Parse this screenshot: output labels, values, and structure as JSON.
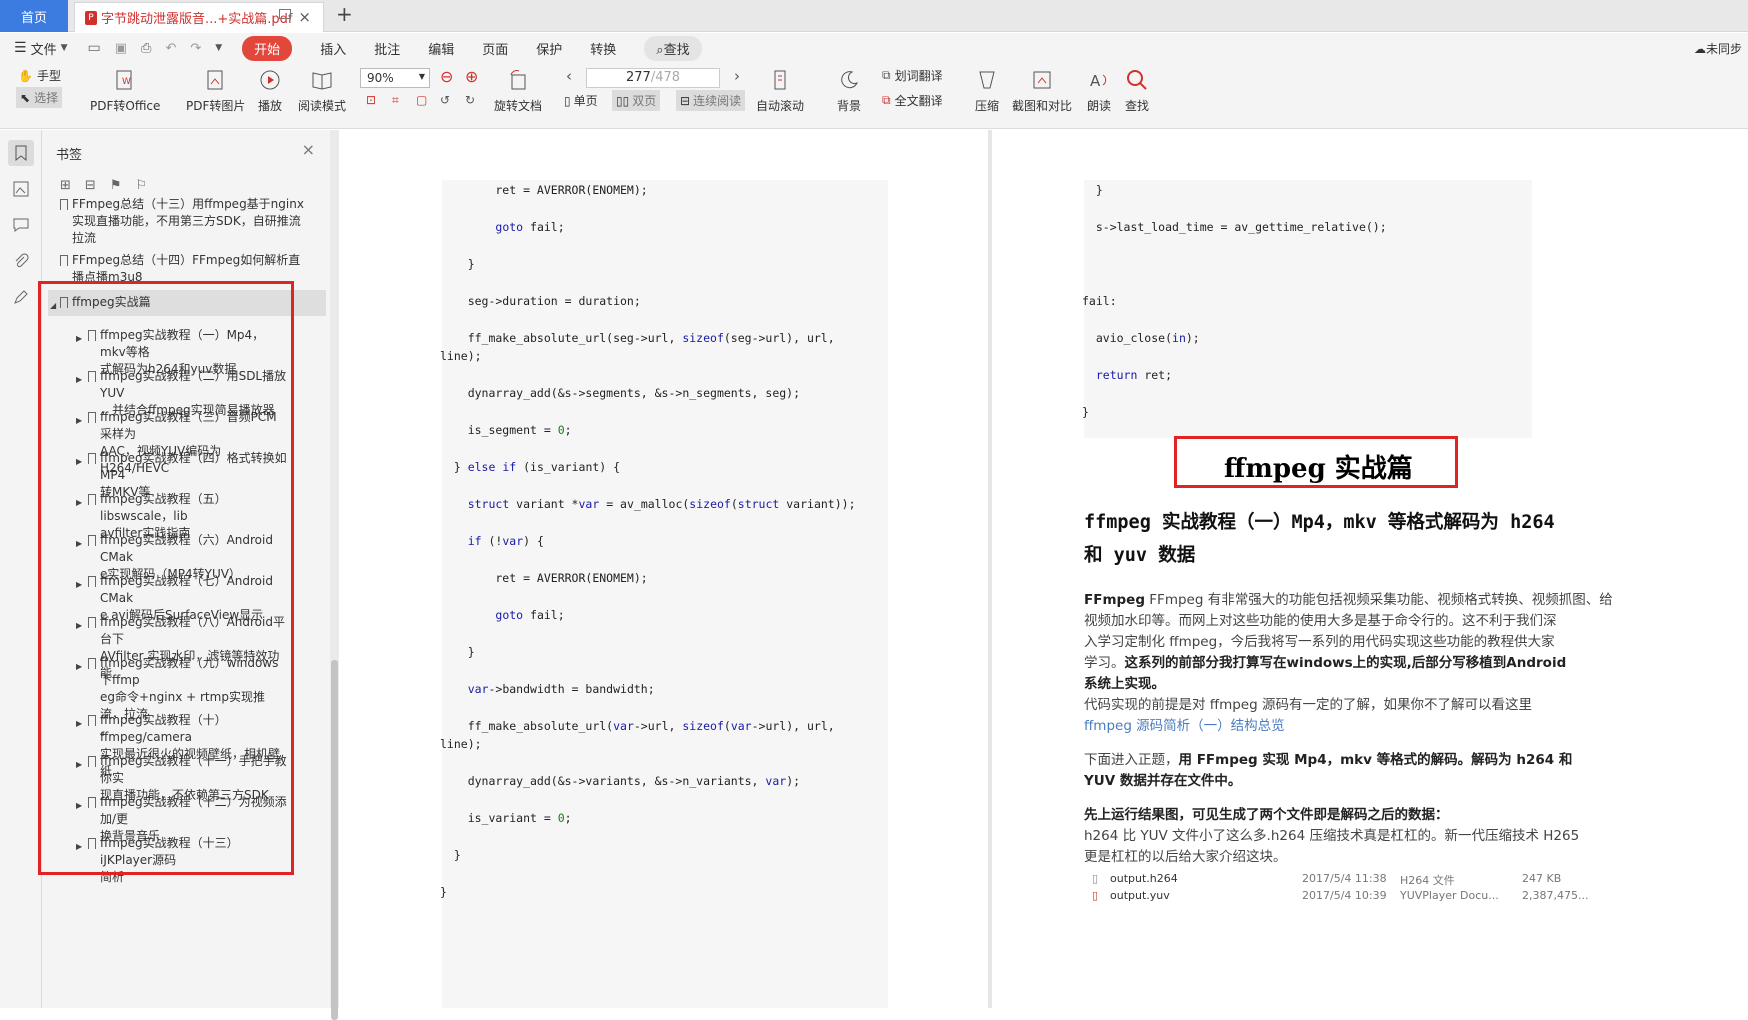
{
  "tabs": {
    "home": "首页",
    "doc_title": "字节跳动泄露版音...+实战篇.pdf",
    "add": "+"
  },
  "menu": {
    "file": "文件",
    "items": [
      "插入",
      "批注",
      "编辑",
      "页面",
      "保护",
      "转换"
    ],
    "active": "开始",
    "search": "查找",
    "sync": "未同步"
  },
  "toolbar": {
    "hand": "手型",
    "select": "选择",
    "pdf_office": "PDF转Office",
    "pdf_image": "PDF转图片",
    "play": "播放",
    "read_mode": "阅读模式",
    "zoom": "90%",
    "rotate": "旋转文档",
    "page_current": "277",
    "page_total": "/478",
    "single": "单页",
    "double": "双页",
    "continuous": "连续阅读",
    "auto_scroll": "自动滚动",
    "background": "背景",
    "word_translate": "划词翻译",
    "full_translate": "全文翻译",
    "compress": "压缩",
    "screenshot": "截图和对比",
    "read_aloud": "朗读",
    "find": "查找"
  },
  "panel": {
    "title": "书签",
    "top_items": [
      "FFmpeg总结（十三）用ffmpeg基于nginx实现直播功能，不用第三方SDK，自研推流拉流",
      "FFmpeg总结（十四）FFmpeg如何解析直播点播m3u8"
    ],
    "section": "ffmpeg实战篇",
    "children": [
      [
        "ffmpeg实战教程（一）Mp4，mkv等格",
        "式解码为h264和yuv数据"
      ],
      [
        "ffmpeg实战教程（二）用SDL播放YUV",
        "，并结合ffmpeg实现简易播放器"
      ],
      [
        "ffmpeg实战教程（三）音频PCM采样为",
        "AAC，视频YUV编码为H264/HEVC"
      ],
      [
        "ffmpeg实战教程（四）格式转换如MP4",
        "转MKV等"
      ],
      [
        "ffmpeg实战教程（五）libswscale，lib",
        "avfilter实践指南"
      ],
      [
        "ffmpeg实战教程（六）Android CMak",
        "e实现解码（MP4转YUV）"
      ],
      [
        "ffmpeg实战教程（七）Android CMak",
        "e avi解码后SurfaceView显示"
      ],
      [
        "ffmpeg实战教程（八）Android平台下",
        "AVfilter 实现水印，滤镜等特效功能"
      ],
      [
        "ffmpeg实战教程（九）windows下ffmp",
        "eg命令+nginx + rtmp实现推流，拉流",
        "。"
      ],
      [
        "ffmpeg实战教程（十）ffmpeg/camera",
        "实现最近很火的视频壁纸，相机壁纸"
      ],
      [
        "ffmpeg实战教程（十一）手把手教你实",
        "现直播功能，不依赖第三方SDK"
      ],
      [
        "ffmpeg实战教程（十二）为视频添加/更",
        "换背景音乐"
      ],
      [
        "ffmpeg实战教程（十三）iJKPlayer源码",
        "简析"
      ]
    ]
  },
  "left_code": [
    "        ret = AVERROR(ENOMEM);",
    "        goto fail;",
    "    }",
    "    seg->duration = duration;",
    "    ff_make_absolute_url(seg->url, sizeof(seg->url), url,",
    "line);",
    "    dynarray_add(&s->segments, &s->n_segments, seg);",
    "    is_segment = 0;",
    "  } else if (is_variant) {",
    "    struct variant *var = av_malloc(sizeof(struct variant));",
    "    if (!var) {",
    "        ret = AVERROR(ENOMEM);",
    "        goto fail;",
    "    }",
    "    var->bandwidth = bandwidth;",
    "    ff_make_absolute_url(var->url, sizeof(var->url), url,",
    "line);",
    "    dynarray_add(&s->variants, &s->n_variants, var);",
    "    is_variant = 0;",
    "  }",
    "}"
  ],
  "right_code": [
    "  }",
    "  s->last_load_time = av_gettime_relative();",
    "fail:",
    "  avio_close(in);",
    "  return ret;",
    "}"
  ],
  "right_page": {
    "title": "ffmpeg 实战篇",
    "heading_l1": "ffmpeg 实战教程（一）Mp4，mkv 等格式解码为 h264",
    "heading_l2": "和 yuv 数据",
    "p1_l1": "FFmpeg 有非常强大的功能包括视频采集功能、视频格式转换、视频抓图、给",
    "p1_l2": "视频加水印等。而网上对这些功能的使用大多是基于命令行的。这不利于我们深",
    "p1_l3": "入学习定制化 ffmpeg，今后我将写一系列的用代码实现这些功能的教程供大家",
    "p1_l4a": "学习。",
    "p1_l4b": "这系列的前部分我打算写在windows上的实现,后部分写移植到Android",
    "p1_l5": "系统上实现。",
    "p2_l1": "代码实现的前提是对 ffmpeg 源码有一定的了解，如果你不了解可以看这里",
    "p2_link": "ffmpeg 源码简析（一）结构总览",
    "p3_l1a": "下面进入正题，",
    "p3_l1b": "用 FFmpeg 实现 Mp4，mkv 等格式的解码。解码为 h264 和",
    "p3_l2": "YUV 数据并存在文件中。",
    "p4_l1": "先上运行结果图，可见生成了两个文件即是解码之后的数据：",
    "p4_l2": "h264 比 YUV 文件小了这么多.h264 压缩技术真是杠杠的。新一代压缩技术 H265",
    "p4_l3": "更是杠杠的以后给大家介绍这块。",
    "files": [
      {
        "name": "output.h264",
        "date": "2017/5/4 11:38",
        "type": "H264 文件",
        "size": "247 KB"
      },
      {
        "name": "output.yuv",
        "date": "2017/5/4 10:39",
        "type": "YUVPlayer Docu...",
        "size": "2,387,475..."
      }
    ]
  },
  "colors": {
    "accent": "#e2473b",
    "highlight": "#e02424",
    "home_tab": "#3c7be0"
  }
}
